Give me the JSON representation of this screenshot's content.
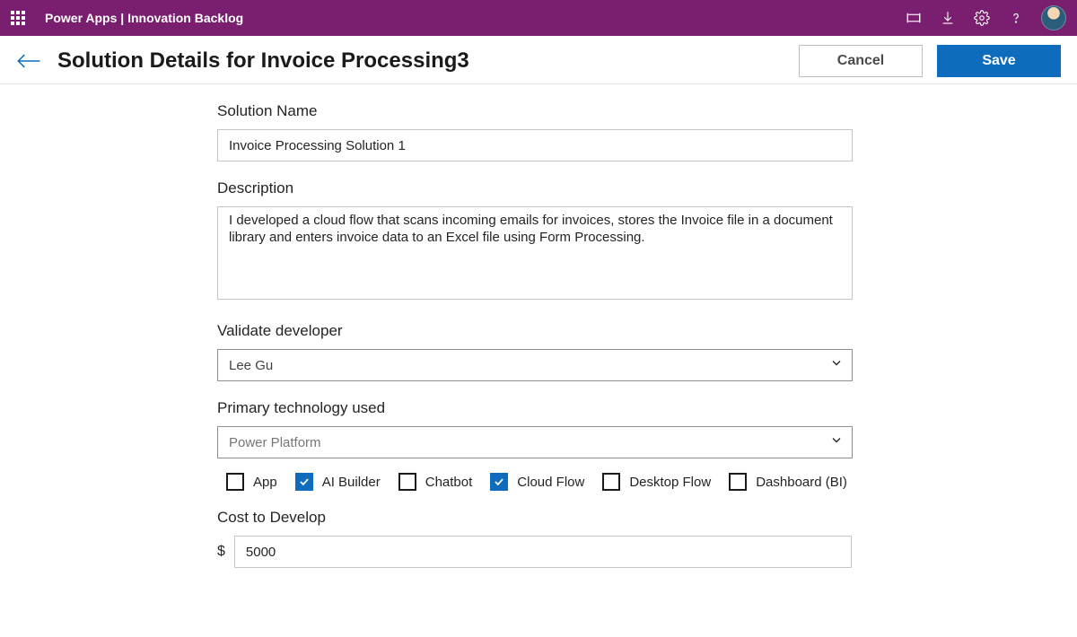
{
  "topbar": {
    "title": "Power Apps  |  Innovation Backlog"
  },
  "header": {
    "title": "Solution Details for Invoice Processing3",
    "cancel": "Cancel",
    "save": "Save"
  },
  "form": {
    "solutionName": {
      "label": "Solution Name",
      "value": "Invoice Processing Solution 1"
    },
    "description": {
      "label": "Description",
      "value": "I developed a cloud flow that scans incoming emails for invoices, stores the Invoice file in a document library and enters invoice data to an Excel file using Form Processing."
    },
    "validateDeveloper": {
      "label": "Validate developer",
      "value": "Lee Gu"
    },
    "primaryTech": {
      "label": "Primary technology used",
      "value": "Power Platform",
      "options": [
        {
          "label": "App",
          "checked": false
        },
        {
          "label": "AI Builder",
          "checked": true
        },
        {
          "label": "Chatbot",
          "checked": false
        },
        {
          "label": "Cloud Flow",
          "checked": true
        },
        {
          "label": "Desktop Flow",
          "checked": false
        },
        {
          "label": "Dashboard (BI)",
          "checked": false
        }
      ]
    },
    "costToDevelop": {
      "label": "Cost to Develop",
      "currency": "$",
      "value": "5000"
    }
  }
}
